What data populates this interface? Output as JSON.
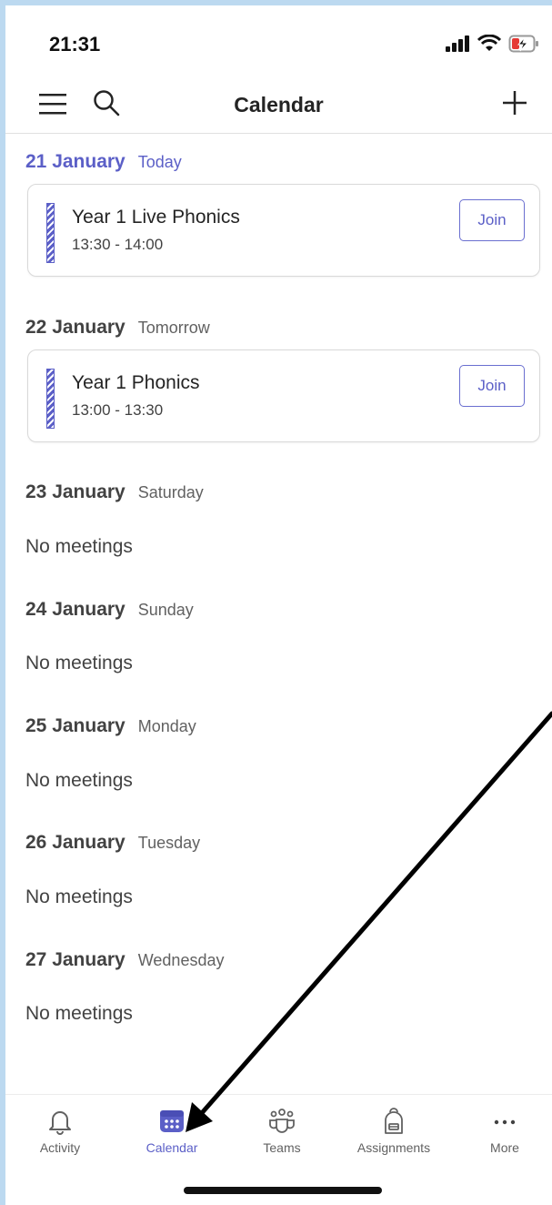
{
  "status_bar": {
    "time": "21:31"
  },
  "header": {
    "title": "Calendar"
  },
  "days": [
    {
      "date": "21 January",
      "relative": "Today"
    },
    {
      "date": "22 January",
      "relative": "Tomorrow"
    },
    {
      "date": "23 January",
      "relative": "Saturday"
    },
    {
      "date": "24 January",
      "relative": "Sunday"
    },
    {
      "date": "25 January",
      "relative": "Monday"
    },
    {
      "date": "26 January",
      "relative": "Tuesday"
    },
    {
      "date": "27 January",
      "relative": "Wednesday"
    }
  ],
  "events": [
    {
      "title": "Year 1 Live Phonics",
      "time": "13:30 - 14:00",
      "join_label": "Join"
    },
    {
      "title": "Year 1 Phonics",
      "time": "13:00 - 13:30",
      "join_label": "Join"
    }
  ],
  "empty_text": "No meetings",
  "bottom_nav": [
    {
      "label": "Activity",
      "icon": "bell-icon",
      "active": false
    },
    {
      "label": "Calendar",
      "icon": "calendar-icon",
      "active": true
    },
    {
      "label": "Teams",
      "icon": "teams-icon",
      "active": false
    },
    {
      "label": "Assignments",
      "icon": "backpack-icon",
      "active": false
    },
    {
      "label": "More",
      "icon": "more-icon",
      "active": false
    }
  ],
  "colors": {
    "accent": "#5b5fc7",
    "text": "#424242",
    "background": "#ffffff"
  }
}
